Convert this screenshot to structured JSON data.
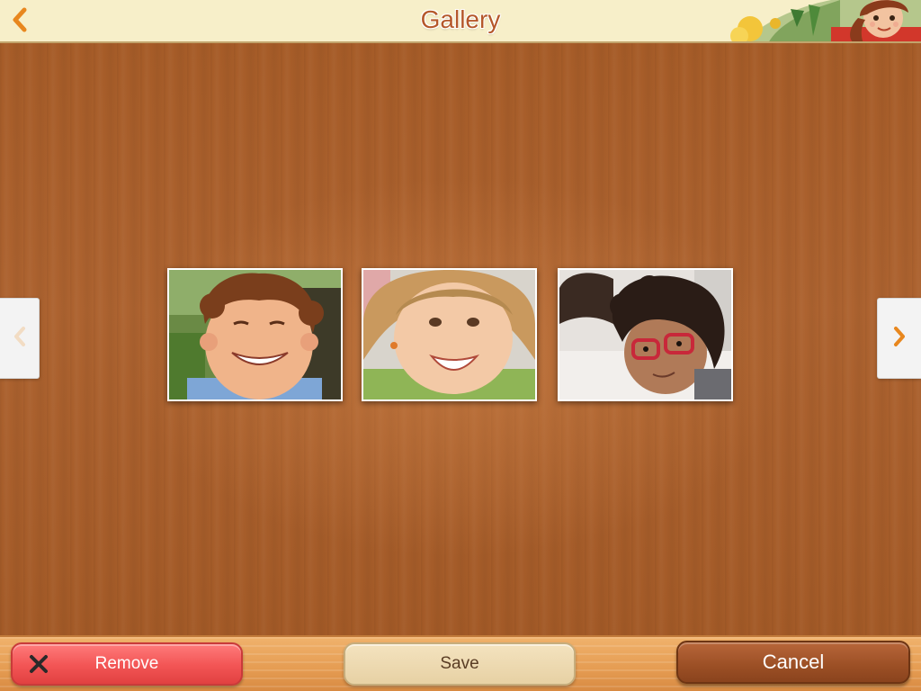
{
  "header": {
    "title": "Gallery",
    "back_icon": "chevron-left-icon",
    "accent_color": "#e8871e"
  },
  "gallery": {
    "photos": [
      {
        "subject": "smiling boy with curly hair"
      },
      {
        "subject": "laughing girl with pigtails"
      },
      {
        "subject": "child with curly hair and red glasses"
      }
    ],
    "prev_icon": "chevron-left-icon",
    "next_icon": "chevron-right-icon"
  },
  "toolbar": {
    "remove_label": "Remove",
    "remove_icon": "close-icon",
    "save_label": "Save",
    "cancel_label": "Cancel",
    "colors": {
      "remove": "#f25454",
      "save": "#e7d1a4",
      "cancel": "#9b4f25"
    }
  }
}
